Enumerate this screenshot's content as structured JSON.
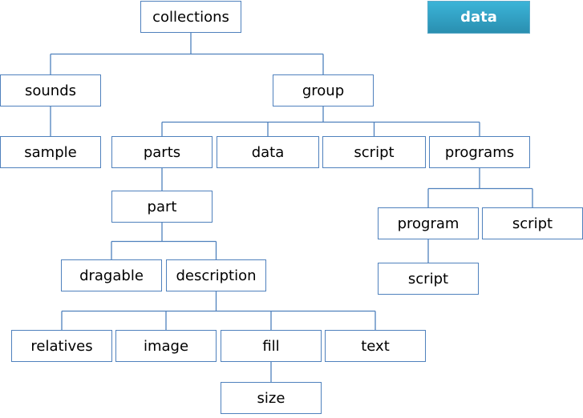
{
  "legend": {
    "label": "data",
    "color": "#2fa3c8"
  },
  "line_color": "#4f81bd",
  "nodes": {
    "collections": "collections",
    "sounds": "sounds",
    "sample": "sample",
    "group": "group",
    "parts": "parts",
    "group_data": "data",
    "group_script": "script",
    "programs": "programs",
    "part": "part",
    "dragable": "dragable",
    "description": "description",
    "program": "program",
    "programs_script": "script",
    "program_script": "script",
    "relatives": "relatives",
    "image": "image",
    "fill": "fill",
    "text": "text",
    "size": "size"
  },
  "edges": [
    [
      "collections",
      "sounds"
    ],
    [
      "collections",
      "group"
    ],
    [
      "sounds",
      "sample"
    ],
    [
      "group",
      "parts"
    ],
    [
      "group",
      "group_data"
    ],
    [
      "group",
      "group_script"
    ],
    [
      "group",
      "programs"
    ],
    [
      "parts",
      "part"
    ],
    [
      "part",
      "dragable"
    ],
    [
      "part",
      "description"
    ],
    [
      "description",
      "relatives"
    ],
    [
      "description",
      "image"
    ],
    [
      "description",
      "fill"
    ],
    [
      "description",
      "text"
    ],
    [
      "fill",
      "size"
    ],
    [
      "programs",
      "program"
    ],
    [
      "programs",
      "programs_script"
    ],
    [
      "program",
      "program_script"
    ]
  ]
}
